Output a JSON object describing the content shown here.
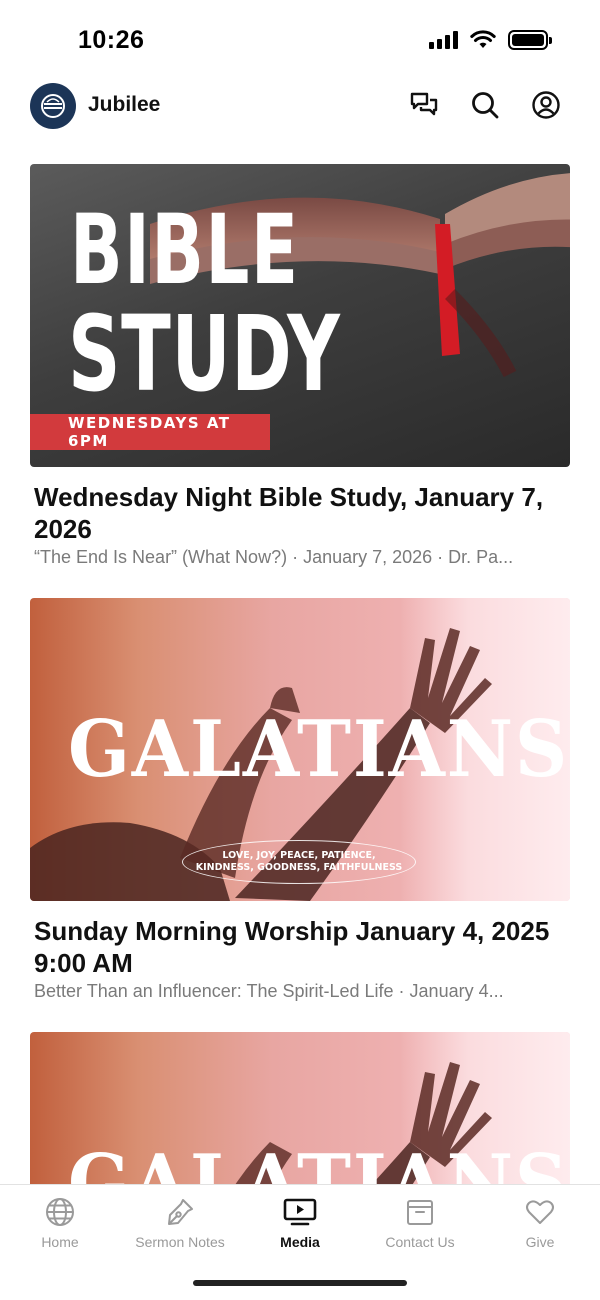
{
  "status_bar": {
    "time": "10:26",
    "icons": [
      "signal-icon",
      "wifi-icon",
      "battery-icon"
    ]
  },
  "header": {
    "app_name": "Jubilee",
    "logo": "jubilee-logo",
    "actions": [
      "messages-icon",
      "search-icon",
      "profile-icon"
    ]
  },
  "feed": [
    {
      "title": "Wednesday Night Bible Study, January 7, 2026",
      "meta": "“The End Is Near” (What Now?) · January 7, 2026 · Dr. Pa...",
      "thumbnail": {
        "line1": "BIBLE",
        "line2": "STUDY",
        "banner": "WEDNESDAYS AT 6PM"
      }
    },
    {
      "title": "Sunday Morning Worship January 4, 2025 9:00 AM",
      "meta": "Better Than an Influencer: The Spirit-Led Life · January 4...",
      "thumbnail": {
        "word": "GALATIANS",
        "subtitle_line1": "LOVE, JOY, PEACE, PATIENCE,",
        "subtitle_line2": "KINDNESS, GOODNESS, FAITHFULNESS"
      }
    },
    {
      "thumbnail": {
        "word": "GALATIANS"
      }
    }
  ],
  "tab_bar": {
    "tabs": [
      {
        "label": "Home",
        "icon": "globe-icon",
        "active": false
      },
      {
        "label": "Sermon Notes",
        "icon": "pen-icon",
        "active": false
      },
      {
        "label": "Media",
        "icon": "media-play-icon",
        "active": true
      },
      {
        "label": "Contact Us",
        "icon": "archive-box-icon",
        "active": false
      },
      {
        "label": "Give",
        "icon": "heart-icon",
        "active": false
      }
    ]
  },
  "colors": {
    "accent_banner": "#d23a3d",
    "logo_bg": "#1c3557",
    "inactive_tab": "#9a9a9a"
  }
}
